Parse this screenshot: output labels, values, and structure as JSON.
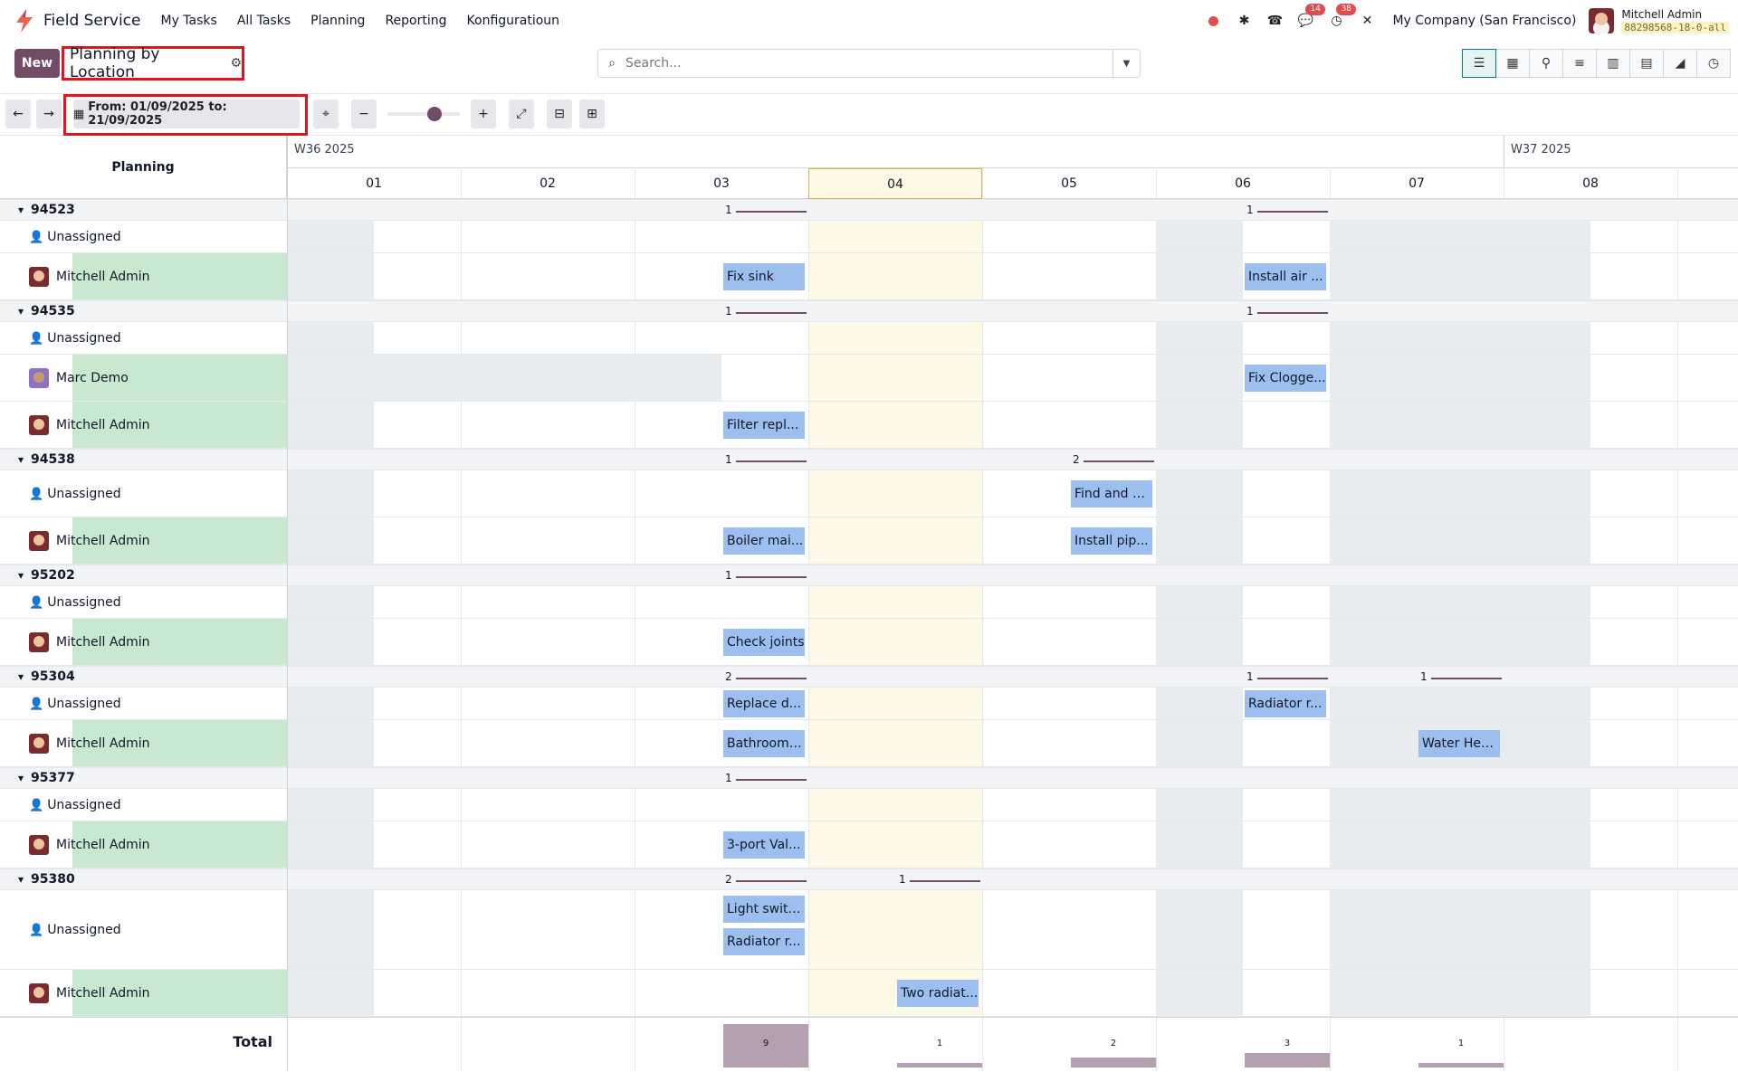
{
  "app": {
    "name": "Field Service"
  },
  "menu": [
    "My Tasks",
    "All Tasks",
    "Planning",
    "Reporting",
    "Konfiguratioun"
  ],
  "systray": {
    "messages_badge": "14",
    "activities_badge": "38",
    "company": "My Company (San Francisco)",
    "user_name": "Mitchell Admin",
    "db_name": "88298568-18-0-all"
  },
  "control": {
    "new_label": "New",
    "view_title": "Planning by Location",
    "search_placeholder": "Search..."
  },
  "toolbar": {
    "date_range": "From: 01/09/2025 to: 21/09/2025"
  },
  "gantt": {
    "header_label": "Planning",
    "weeks": [
      {
        "label": "W36 2025"
      },
      {
        "label": "W37 2025"
      }
    ],
    "days": [
      "01",
      "02",
      "03",
      "04",
      "05",
      "06",
      "07",
      "08"
    ],
    "today_col": 3,
    "groups": [
      {
        "name": "94523",
        "rows": [
          "Unassigned",
          "Mitchell Admin"
        ]
      },
      {
        "name": "94535",
        "rows": [
          "Unassigned",
          "Marc Demo",
          "Mitchell Admin"
        ]
      },
      {
        "name": "94538",
        "rows": [
          "Unassigned",
          "Mitchell Admin"
        ]
      },
      {
        "name": "95202",
        "rows": [
          "Unassigned",
          "Mitchell Admin"
        ]
      },
      {
        "name": "95304",
        "rows": [
          "Unassigned",
          "Mitchell Admin"
        ]
      },
      {
        "name": "95377",
        "rows": [
          "Unassigned",
          "Mitchell Admin"
        ]
      },
      {
        "name": "95380",
        "rows": [
          "Unassigned",
          "Mitchell Admin"
        ]
      }
    ],
    "group_counts": [
      {
        "group": 0,
        "col": 2,
        "count": "1"
      },
      {
        "group": 0,
        "col": 5,
        "count": "1"
      },
      {
        "group": 1,
        "col": 2,
        "count": "1"
      },
      {
        "group": 1,
        "col": 5,
        "count": "1"
      },
      {
        "group": 2,
        "col": 2,
        "count": "1"
      },
      {
        "group": 2,
        "col": 4,
        "count": "2"
      },
      {
        "group": 3,
        "col": 2,
        "count": "1"
      },
      {
        "group": 4,
        "col": 2,
        "count": "2"
      },
      {
        "group": 4,
        "col": 5,
        "count": "1"
      },
      {
        "group": 4,
        "col": 6,
        "count": "1"
      },
      {
        "group": 5,
        "col": 2,
        "count": "1"
      },
      {
        "group": 6,
        "col": 2,
        "count": "2"
      },
      {
        "group": 6,
        "col": 3,
        "count": "1"
      }
    ],
    "tasks": [
      {
        "group": 0,
        "row": 1,
        "col": 2,
        "label": "Fix sink"
      },
      {
        "group": 0,
        "row": 1,
        "col": 5,
        "label": "Install air ..."
      },
      {
        "group": 1,
        "row": 1,
        "col": 5,
        "label": "Fix Clogge..."
      },
      {
        "group": 1,
        "row": 2,
        "col": 2,
        "label": "Filter repl..."
      },
      {
        "group": 2,
        "row": 0,
        "col": 4,
        "label": "Find and fi..."
      },
      {
        "group": 2,
        "row": 1,
        "col": 2,
        "label": "Boiler mai..."
      },
      {
        "group": 2,
        "row": 1,
        "col": 4,
        "label": "Install pip..."
      },
      {
        "group": 3,
        "row": 1,
        "col": 2,
        "label": "Check joints"
      },
      {
        "group": 4,
        "row": 0,
        "col": 2,
        "label": "Replace d..."
      },
      {
        "group": 4,
        "row": 0,
        "col": 5,
        "label": "Radiator r..."
      },
      {
        "group": 4,
        "row": 1,
        "col": 2,
        "label": "Bathroom ..."
      },
      {
        "group": 4,
        "row": 1,
        "col": 6,
        "label": "Water Hea..."
      },
      {
        "group": 5,
        "row": 1,
        "col": 2,
        "label": "3-port Val..."
      },
      {
        "group": 6,
        "row": 0,
        "col": 2,
        "label": "Light switc...",
        "slot": 0
      },
      {
        "group": 6,
        "row": 0,
        "col": 2,
        "label": "Radiator r...",
        "slot": 1
      },
      {
        "group": 6,
        "row": 1,
        "col": 3,
        "label": "Two radiat..."
      }
    ],
    "total_label": "Total",
    "totals": [
      {
        "col": 2,
        "value": 9
      },
      {
        "col": 3,
        "value": 1
      },
      {
        "col": 4,
        "value": 2
      },
      {
        "col": 5,
        "value": 3
      },
      {
        "col": 6,
        "value": 1
      }
    ],
    "colors": {
      "task": "#9cbff0",
      "today": "#fef9e7",
      "offday": "#e9ecef",
      "assigned": "#c9e8d0",
      "accent": "#714b67"
    }
  }
}
